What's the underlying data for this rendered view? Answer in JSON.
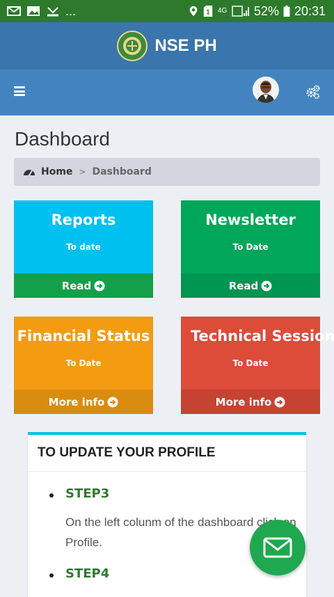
{
  "status_bar": {
    "icons_left": [
      "mail-icon",
      "image-icon",
      "missed-call-icon"
    ],
    "overflow": "...",
    "icons_right": [
      "location-icon",
      "sim-icon",
      "network-icon",
      "signal-icon",
      "battery-icon"
    ],
    "network": "4G",
    "battery": "52%",
    "time": "20:31"
  },
  "header": {
    "brand": "NSE PH"
  },
  "page": {
    "title": "Dashboard"
  },
  "breadcrumb": {
    "home": "Home",
    "separator": ">",
    "current": "Dashboard"
  },
  "cards": [
    {
      "title": "Reports",
      "subtitle": "To date",
      "footer": "Read",
      "color": "#00c0ef",
      "footer_color": "#12a04a"
    },
    {
      "title": "Newsletter",
      "subtitle": "To Date",
      "footer": "Read",
      "color": "#00a65a",
      "footer_color": "#009551"
    },
    {
      "title": "Financial Status",
      "subtitle": "To Date",
      "footer": "More info",
      "color": "#f39c12",
      "footer_color": "#da8c10"
    },
    {
      "title": "Technical Session",
      "subtitle": "To Date",
      "footer": "More info",
      "color": "#dd4b39",
      "footer_color": "#c64333"
    }
  ],
  "profile": {
    "heading": "TO UPDATE YOUR PROFILE",
    "steps": [
      {
        "title": "STEP3",
        "text": "On the left colunm of the dashboard click on Profile."
      },
      {
        "title": "STEP4",
        "text": ""
      }
    ]
  },
  "colors": {
    "status_bar": "#2d7a2d",
    "header": "#3a76ab",
    "navbar": "#4384c0",
    "fab": "#1fa84f"
  }
}
